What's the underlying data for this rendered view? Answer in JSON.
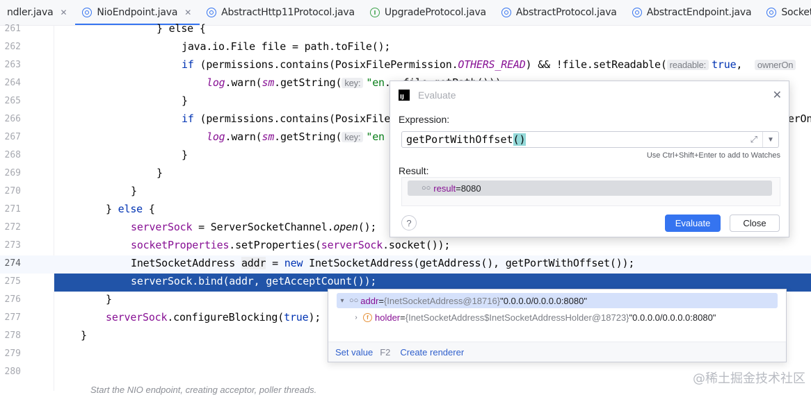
{
  "tabs": [
    {
      "label": "ndler.java",
      "icon": "none",
      "active": false
    },
    {
      "label": "NioEndpoint.java",
      "icon": "class",
      "active": true
    },
    {
      "label": "AbstractHttp11Protocol.java",
      "icon": "abstract",
      "active": false
    },
    {
      "label": "UpgradeProtocol.java",
      "icon": "interface",
      "active": false
    },
    {
      "label": "AbstractProtocol.java",
      "icon": "abstract",
      "active": false
    },
    {
      "label": "AbstractEndpoint.java",
      "icon": "abstract",
      "active": false
    },
    {
      "label": "SocketP",
      "icon": "class",
      "active": false
    }
  ],
  "editor": {
    "line_numbers": [
      "261",
      "262",
      "263",
      "264",
      "265",
      "266",
      "267",
      "268",
      "269",
      "270",
      "271",
      "272",
      "273",
      "274",
      "275",
      "276",
      "277",
      "278",
      "279",
      "280"
    ],
    "caret_line": "274",
    "selected_line": "275",
    "code": {
      "l261": "} else {",
      "l262": "java.io.File file = path.toFile();",
      "l263a": "if",
      "l263b": " (permissions.contains(PosixFilePermission.",
      "l263c": "OTHERS_READ",
      "l263d": ") && !file.setReadable(",
      "l263hint": "readable:",
      "l263e": "true",
      "l263f": ",",
      "l263hint2": "ownerOn",
      "l264a": "log",
      "l264b": ".warn(",
      "l264c": "sm",
      "l264d": ".getString(",
      "l264hint": "key:",
      "l264e": "\"en",
      "l264f": "...file.getPath()));",
      "l265": "}",
      "l266a": "if",
      "l266b": " (permissions.contains(PosixFile",
      "l266c": "nerOn",
      "l267a": "log",
      "l267b": ".warn(",
      "l267c": "sm",
      "l267d": ".getString(",
      "l267hint": "key:",
      "l267e": "\"en",
      "l268": "}",
      "l269": "}",
      "l270": "}",
      "l271a": "} ",
      "l271b": "else",
      "l271c": " {",
      "l272a": "serverSock",
      "l272b": " = ServerSocketChannel.",
      "l272c": "open",
      "l272d": "();",
      "l273a": "socketProperties",
      "l273b": ".setProperties(",
      "l273c": "serverSock",
      "l273d": ".socket());",
      "l274a": "InetSocketAddress ",
      "l274b": "addr",
      "l274c": " = ",
      "l274d": "new",
      "l274e": " InetSocketAddress(getAddress(), getPortWithOffset());",
      "l275": "serverSock.bind(addr, getAcceptCount());",
      "l276": "}",
      "l277a": "serverSock",
      "l277b": ".configureBlocking(",
      "l277c": "true",
      "l277d": ");",
      "l278": "}"
    },
    "footnote": "Start the NIO endpoint, creating acceptor, poller threads.",
    "watermark": "@稀土掘金技术社区"
  },
  "evaluate_dialog": {
    "title": "Evaluate",
    "expression_label": "Expression:",
    "expression_main": "getPortWithOffset",
    "expression_parens": "()",
    "watches_hint": "Use Ctrl+Shift+Enter to add to Watches",
    "result_label": "Result:",
    "result_name": "result",
    "result_eq": " = ",
    "result_value": "8080",
    "help_glyph": "?",
    "evaluate_button": "Evaluate",
    "close_button": "Close"
  },
  "value_popup": {
    "rows": [
      {
        "name": "addr",
        "eq": " = ",
        "type": "{InetSocketAddress@18716}",
        "value": " \"0.0.0.0/0.0.0.0:8080\""
      },
      {
        "name": "holder",
        "eq": " = ",
        "type": "{InetSocketAddress$InetSocketAddressHolder@18723}",
        "value": " \"0.0.0.0/0.0.0.0:8080\""
      }
    ],
    "set_value": "Set value",
    "set_value_key": "F2",
    "create_renderer": "Create renderer"
  },
  "colors": {
    "accent": "#3574f0",
    "selection": "#2154a8",
    "keyword": "#0033b3",
    "field": "#871094",
    "string": "#067d17"
  }
}
